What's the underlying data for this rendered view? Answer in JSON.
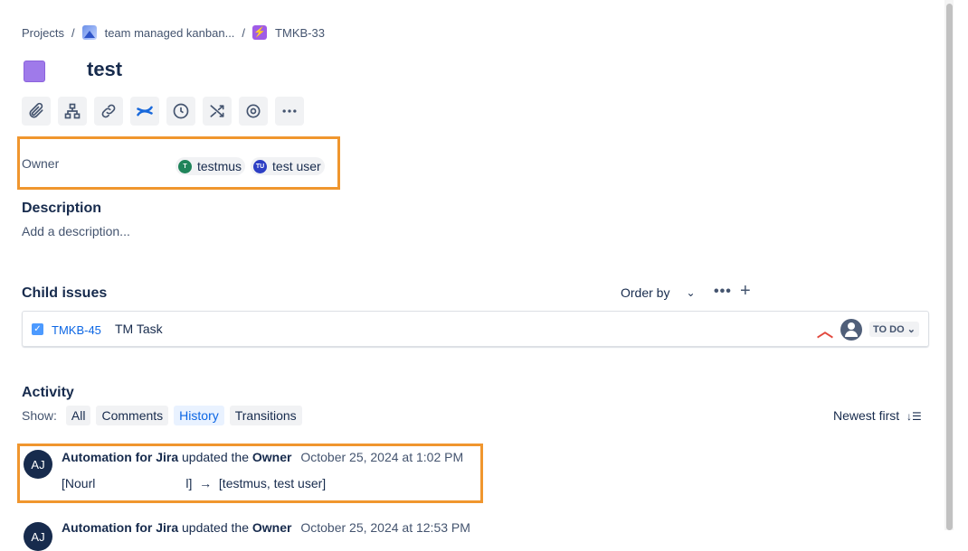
{
  "breadcrumb": {
    "projects": "Projects",
    "project_name": "team managed kanban...",
    "epic_key": "TMKB-33"
  },
  "issue": {
    "title": "test"
  },
  "toolbar_icons": [
    "attachment-icon",
    "hierarchy-icon",
    "link-icon",
    "confluence-icon",
    "clock-icon",
    "shuffle-icon",
    "target-icon",
    "more-icon"
  ],
  "owner": {
    "label": "Owner",
    "users": [
      {
        "initials": "T",
        "name": "testmus",
        "color": "#1f845a"
      },
      {
        "initials": "TU",
        "name": "test user",
        "color": "#2d3fc4"
      }
    ]
  },
  "description": {
    "title": "Description",
    "placeholder": "Add a description..."
  },
  "child_issues": {
    "title": "Child issues",
    "order_by": "Order by",
    "items": [
      {
        "key": "TMKB-45",
        "summary": "TM Task",
        "status": "TO DO"
      }
    ]
  },
  "activity": {
    "title": "Activity",
    "show_label": "Show:",
    "filters": [
      "All",
      "Comments",
      "History",
      "Transitions"
    ],
    "active_filter": "History",
    "sort": "Newest first",
    "entries": [
      {
        "avatar": "AJ",
        "actor": "Automation for Jira",
        "action": "updated the",
        "field": "Owner",
        "date": "October 25, 2024 at 1:02 PM",
        "from": "[Nourl",
        "from_end": "l]",
        "arrow": "→",
        "to": "[testmus, test user]"
      },
      {
        "avatar": "AJ",
        "actor": "Automation for Jira",
        "action": "updated the",
        "field": "Owner",
        "date": "October 25, 2024 at 12:53 PM"
      }
    ]
  }
}
